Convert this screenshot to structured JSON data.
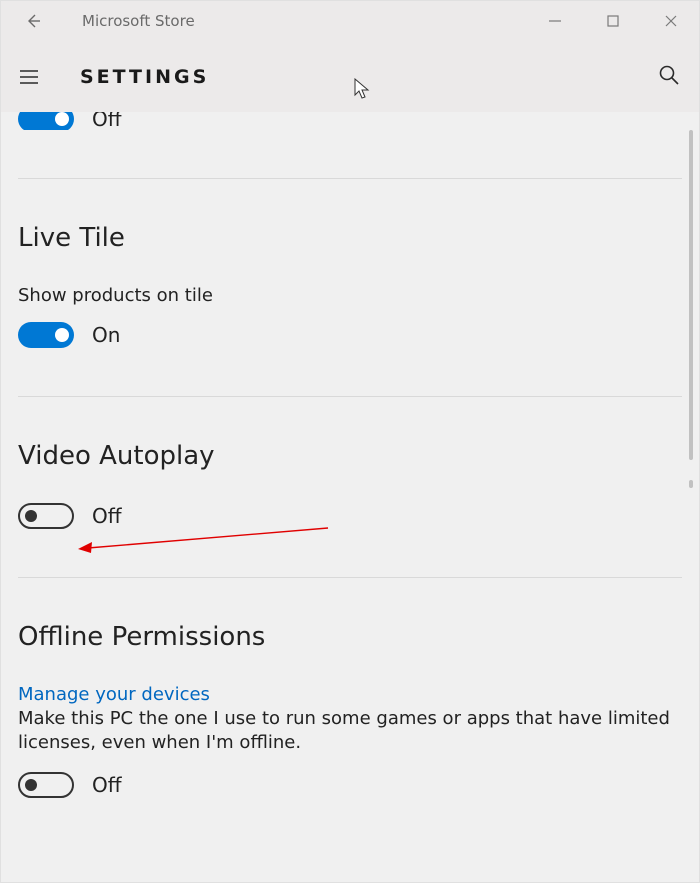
{
  "window": {
    "app_title": "Microsoft Store"
  },
  "cmdbar": {
    "heading": "SETTINGS"
  },
  "partial_top": {
    "state_label": "Off"
  },
  "sections": {
    "live_tile": {
      "title": "Live Tile",
      "setting_label": "Show products on tile",
      "state_label": "On"
    },
    "video_autoplay": {
      "title": "Video Autoplay",
      "state_label": "Off"
    },
    "offline_permissions": {
      "title": "Offline Permissions",
      "link_label": "Manage your devices",
      "description": "Make this PC the one I use to run some games or apps that have limited licenses, even when I'm offline.",
      "state_label": "Off"
    }
  }
}
